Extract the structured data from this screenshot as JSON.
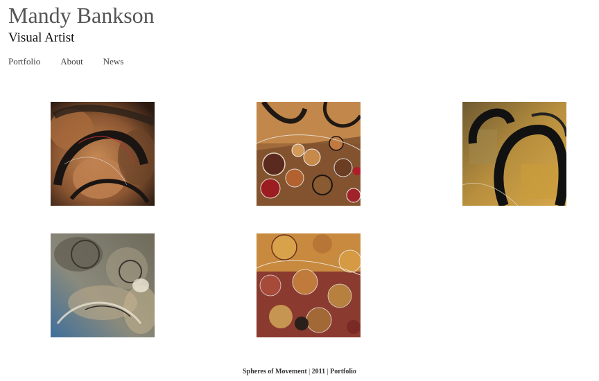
{
  "site": {
    "title": "Mandy Bankson",
    "subtitle": "Visual Artist"
  },
  "nav": {
    "items": [
      "Portfolio",
      "About",
      "News"
    ]
  },
  "gallery": {
    "artwork_count": 5
  },
  "footer": {
    "series": "Spheres of Movement",
    "separator": "|",
    "year": "2011",
    "link": "Portfolio"
  }
}
